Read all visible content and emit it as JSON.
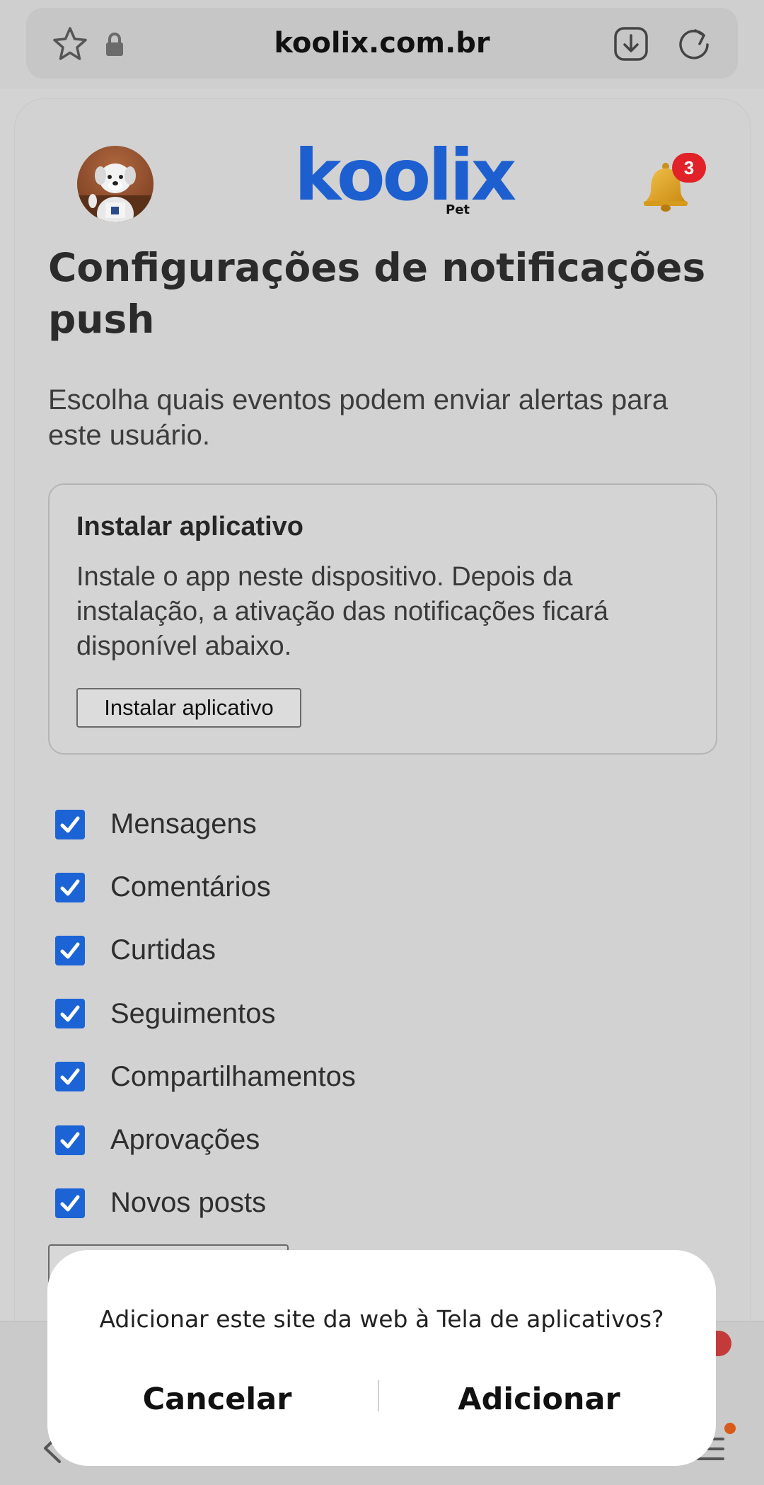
{
  "browser": {
    "url": "koolix.com.br",
    "icons": [
      "star-icon",
      "lock-icon",
      "download-icon",
      "reload-icon"
    ]
  },
  "header": {
    "brand": "koolix",
    "brand_sub": "Pet",
    "notification_count": "3"
  },
  "page": {
    "title": "Configurações de notificações push",
    "description": "Escolha quais eventos podem enviar alertas para este usuário."
  },
  "install": {
    "title": "Instalar aplicativo",
    "description": "Instale o app neste dispositivo. Depois da instalação, a ativação das notificações ficará disponível abaixo.",
    "button": "Instalar aplicativo"
  },
  "preferences": [
    {
      "label": "Mensagens",
      "checked": true
    },
    {
      "label": "Comentários",
      "checked": true
    },
    {
      "label": "Curtidas",
      "checked": true
    },
    {
      "label": "Seguimentos",
      "checked": true
    },
    {
      "label": "Compartilhamentos",
      "checked": true
    },
    {
      "label": "Aprovações",
      "checked": true
    },
    {
      "label": "Novos posts",
      "checked": true
    }
  ],
  "dialog": {
    "message": "Adicionar este site da web à Tela de aplicativos?",
    "cancel": "Cancelar",
    "confirm": "Adicionar"
  },
  "colors": {
    "brand": "#1e5fd0",
    "checkbox": "#1c64d6",
    "badge": "#e12228"
  }
}
